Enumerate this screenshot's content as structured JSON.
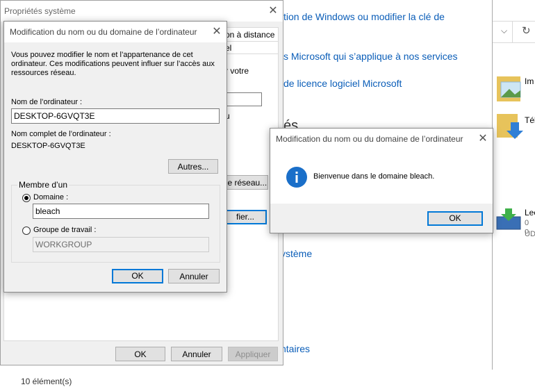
{
  "control_panel": {
    "links": [
      "tion de Windows ou modifier la clé de",
      "s Microsoft qui s’applique à nos services",
      "de licence logiciel Microsoft",
      "ystème",
      ")",
      "ntaires"
    ],
    "heading_fragment": "és"
  },
  "explorer": {
    "items": [
      {
        "label": "Im",
        "icon": "picture-folder-icon"
      },
      {
        "label": "Tél",
        "icon": "download-folder-icon"
      },
      {
        "label": "Lec",
        "sub1": "0 o",
        "sub2": "UD",
        "icon": "dvd-drive-icon"
      }
    ],
    "status": "10 élément(s)"
  },
  "sysprops": {
    "title": "Propriétés système",
    "tab_fragments": [
      "on à distance",
      "el"
    ],
    "text_fragments": [
      "r votre",
      "u"
    ],
    "network_btn": "le réseau...",
    "change_btn": "fier...",
    "ok": "OK",
    "cancel": "Annuler",
    "apply": "Appliquer"
  },
  "rename_dialog": {
    "title": "Modification du nom ou du domaine de l’ordinateur",
    "description": "Vous pouvez modifier le nom et l’appartenance de cet ordinateur. Ces modifications peuvent influer sur l’accès aux ressources réseau.",
    "computer_name_label": "Nom de l’ordinateur :",
    "computer_name_value": "DESKTOP-6GVQT3E",
    "full_name_label": "Nom complet de l’ordinateur :",
    "full_name_value": "DESKTOP-6GVQT3E",
    "more_btn": "Autres...",
    "member_of_label": "Membre d’un",
    "domain_label": "Domaine :",
    "domain_value": "bleach",
    "workgroup_label": "Groupe de travail :",
    "workgroup_value": "WORKGROUP",
    "ok": "OK",
    "cancel": "Annuler"
  },
  "welcome_dialog": {
    "title": "Modification du nom ou du domaine de l’ordinateur",
    "message": "Bienvenue dans le domaine bleach.",
    "ok": "OK",
    "icon": "info-icon",
    "accent": "#1a6fc9"
  }
}
